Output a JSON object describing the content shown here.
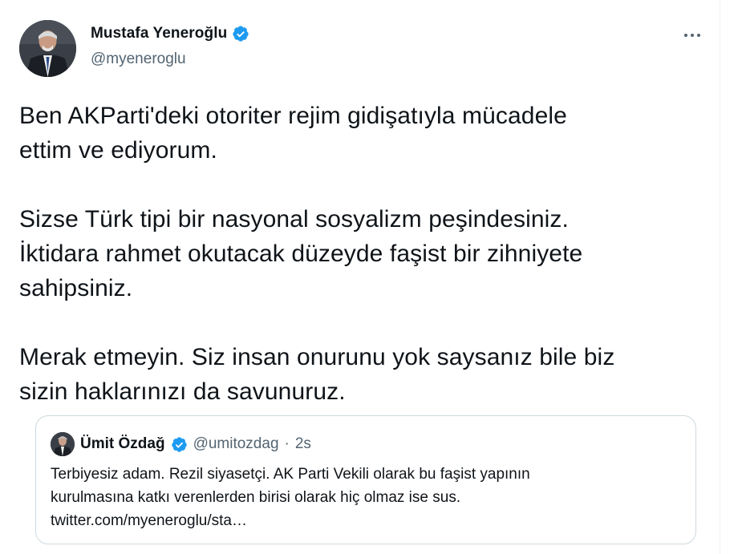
{
  "author": {
    "display_name": "Mustafa Yeneroğlu",
    "handle": "@myeneroglu",
    "verified": true,
    "avatar_icon": "profile-photo-icon"
  },
  "more_icon": "more-options-icon",
  "tweet_text": "Ben AKParti'deki otoriter rejim gidişatıyla mücadele\nettim ve ediyorum.\n\nSizse Türk tipi bir nasyonal sosyalizm peşindesiniz.\nİktidara rahmet okutacak düzeyde faşist bir zihniyete\nsahipsiniz.\n\nMerak etmeyin. Siz insan onurunu yok saysanız bile biz\nsizin haklarınızı da savunuruz.",
  "quoted": {
    "display_name": "Ümit Özdağ",
    "handle": "@umitozdag",
    "separator": "·",
    "time": "2s",
    "verified": true,
    "text_lines": [
      "Terbiyesiz adam. Rezil siyasetçi. AK Parti Vekili olarak bu faşist yapının",
      "kurulmasına katkı verenlerden birisi olarak hiç olmaz ise sus.",
      "twitter.com/myeneroglu/sta…"
    ]
  },
  "colors": {
    "text_primary": "#0f1419",
    "text_secondary": "#536471",
    "verified_blue": "#1d9bf0",
    "border": "#cfd9de"
  }
}
